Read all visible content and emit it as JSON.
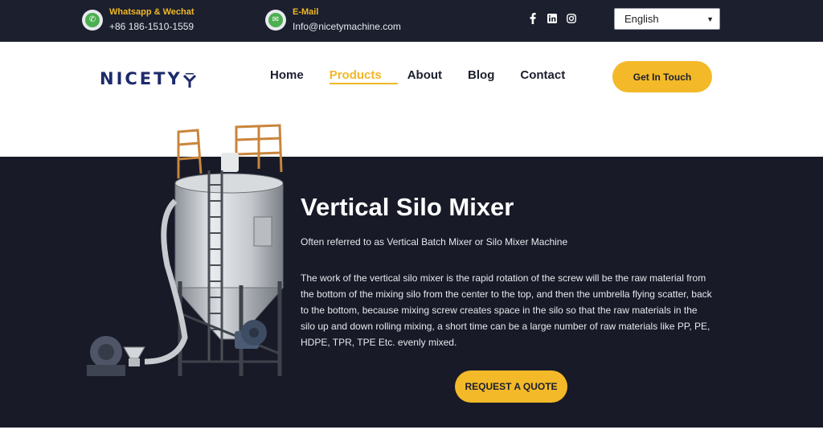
{
  "topbar": {
    "whatsapp": {
      "label": "Whatsapp & Wechat",
      "value": "+86 186-1510-1559",
      "icon": "whatsapp-icon"
    },
    "email": {
      "label": "E-Mail",
      "value": "Info@nicetymachine.com",
      "icon": "email-icon"
    },
    "social": [
      "facebook-icon",
      "linkedin-icon",
      "instagram-icon"
    ],
    "language": "English"
  },
  "nav": {
    "logo": "NICETY",
    "items": [
      {
        "label": "Home",
        "active": false
      },
      {
        "label": "Products",
        "active": true
      },
      {
        "label": "About",
        "active": false
      },
      {
        "label": "Blog",
        "active": false
      },
      {
        "label": "Contact",
        "active": false
      }
    ],
    "cta": "Get In Touch"
  },
  "hero": {
    "title": "Vertical Silo Mixer",
    "subtitle": "Often referred to as Vertical Batch Mixer or Silo Mixer Machine",
    "description": "The work of the vertical silo mixer is the rapid rotation of the screw will be the raw material from the bottom of the mixing silo from the center to the top, and then the umbrella flying scatter, back to the bottom, because mixing screw creates space in the silo so that the raw materials in the silo up and down rolling mixing, a short time can be a large number of raw materials like PP, PE, HDPE, TPR, TPE Etc. evenly mixed.",
    "button": "REQUEST A QUOTE"
  },
  "colors": {
    "accent": "#f3b928",
    "dark": "#181a27",
    "topbar": "#1b1f2e",
    "brand": "#1d2a6b"
  }
}
